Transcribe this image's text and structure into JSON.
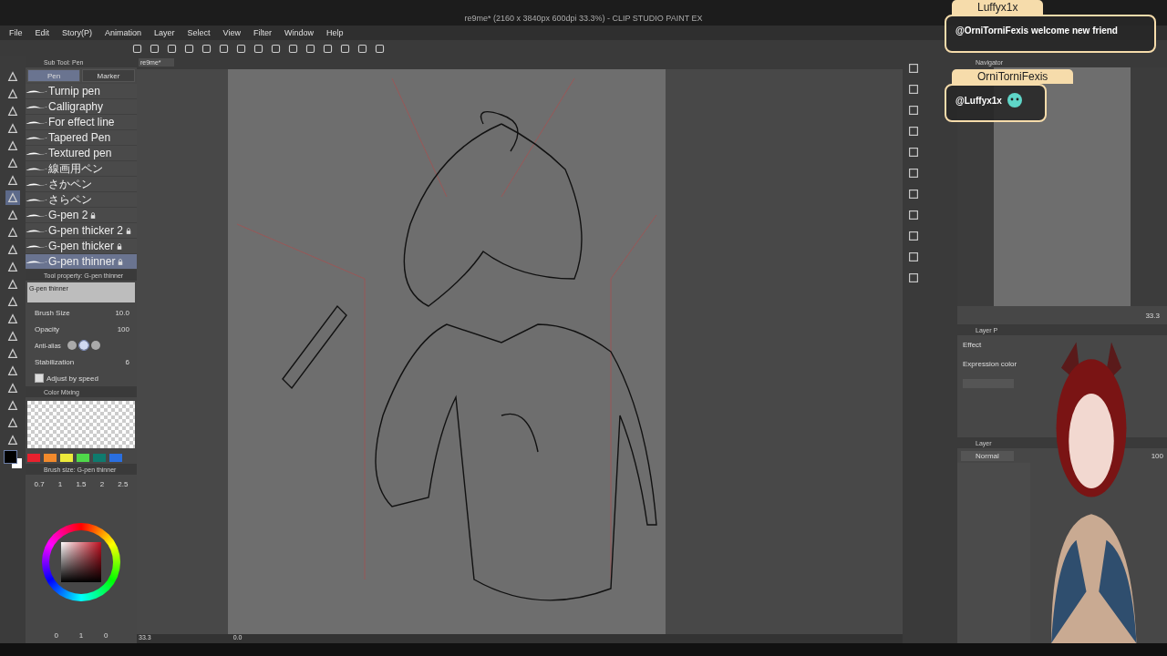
{
  "window": {
    "title": "re9me* (2160 x 3840px 600dpi 33.3%) - CLIP STUDIO PAINT EX"
  },
  "menu": [
    "File",
    "Edit",
    "Story(P)",
    "Animation",
    "Layer",
    "Select",
    "View",
    "Filter",
    "Window",
    "Help"
  ],
  "sub_tool": {
    "title": "Sub Tool: Pen",
    "tabs": [
      {
        "label": "Pen",
        "selected": true
      },
      {
        "label": "Marker",
        "selected": false
      }
    ],
    "brushes": [
      {
        "name": "Turnip pen",
        "locked": false,
        "selected": false
      },
      {
        "name": "Calligraphy",
        "locked": false,
        "selected": false
      },
      {
        "name": "For effect line",
        "locked": false,
        "selected": false
      },
      {
        "name": "Tapered Pen",
        "locked": false,
        "selected": false
      },
      {
        "name": "Textured pen",
        "locked": false,
        "selected": false
      },
      {
        "name": "線画用ペン",
        "locked": false,
        "selected": false
      },
      {
        "name": "さかペン",
        "locked": false,
        "selected": false
      },
      {
        "name": "さらペン",
        "locked": false,
        "selected": false
      },
      {
        "name": "G-pen 2",
        "locked": true,
        "selected": false
      },
      {
        "name": "G-pen thicker 2",
        "locked": true,
        "selected": false
      },
      {
        "name": "G-pen thicker",
        "locked": true,
        "selected": false
      },
      {
        "name": "G-pen thinner",
        "locked": true,
        "selected": true
      }
    ]
  },
  "tool_property": {
    "title": "Tool property: G-pen thinner",
    "preview_label": "G-pen thinner",
    "rows": [
      {
        "kind": "value",
        "label": "Brush Size",
        "value": "10.0"
      },
      {
        "kind": "value",
        "label": "Opacity",
        "value": "100"
      },
      {
        "kind": "antialias",
        "label": "Anti-alias"
      },
      {
        "kind": "value",
        "label": "Stabilization",
        "value": "6"
      },
      {
        "kind": "check",
        "label": "Adjust by speed",
        "checked": true
      }
    ]
  },
  "color_mixing": {
    "title": "Color Mixing",
    "swatches": [
      {
        "color": "#e8212e"
      },
      {
        "color": "#f28a2c"
      },
      {
        "color": "#ecea3a"
      },
      {
        "color": "#4fd84a"
      },
      {
        "color": "#0f7b6e"
      },
      {
        "color": "#2a6fe0"
      }
    ]
  },
  "brush_size": {
    "title": "Brush size: G-pen thinner",
    "sizes": [
      "0.7",
      "1",
      "1.5",
      "2",
      "2.5"
    ]
  },
  "color_wheel": {
    "values": [
      "0",
      "1",
      "0"
    ]
  },
  "canvas": {
    "tab": "re9me*",
    "zoom": "33.3",
    "angle": "0.0"
  },
  "navigator": {
    "tab": "Navigator",
    "zoom": "33.3"
  },
  "layer_property": {
    "title": "Layer P",
    "section": "Effect",
    "field": "Expression color"
  },
  "layer_panel": {
    "title": "Layer",
    "blend": "Normal",
    "opacity": "100"
  },
  "chat": [
    {
      "user": "Luffyx1x",
      "message": "@OrniTorniFexis welcome new friend"
    },
    {
      "user": "OrniTorniFexis",
      "message": "@Luffyx1x"
    }
  ]
}
